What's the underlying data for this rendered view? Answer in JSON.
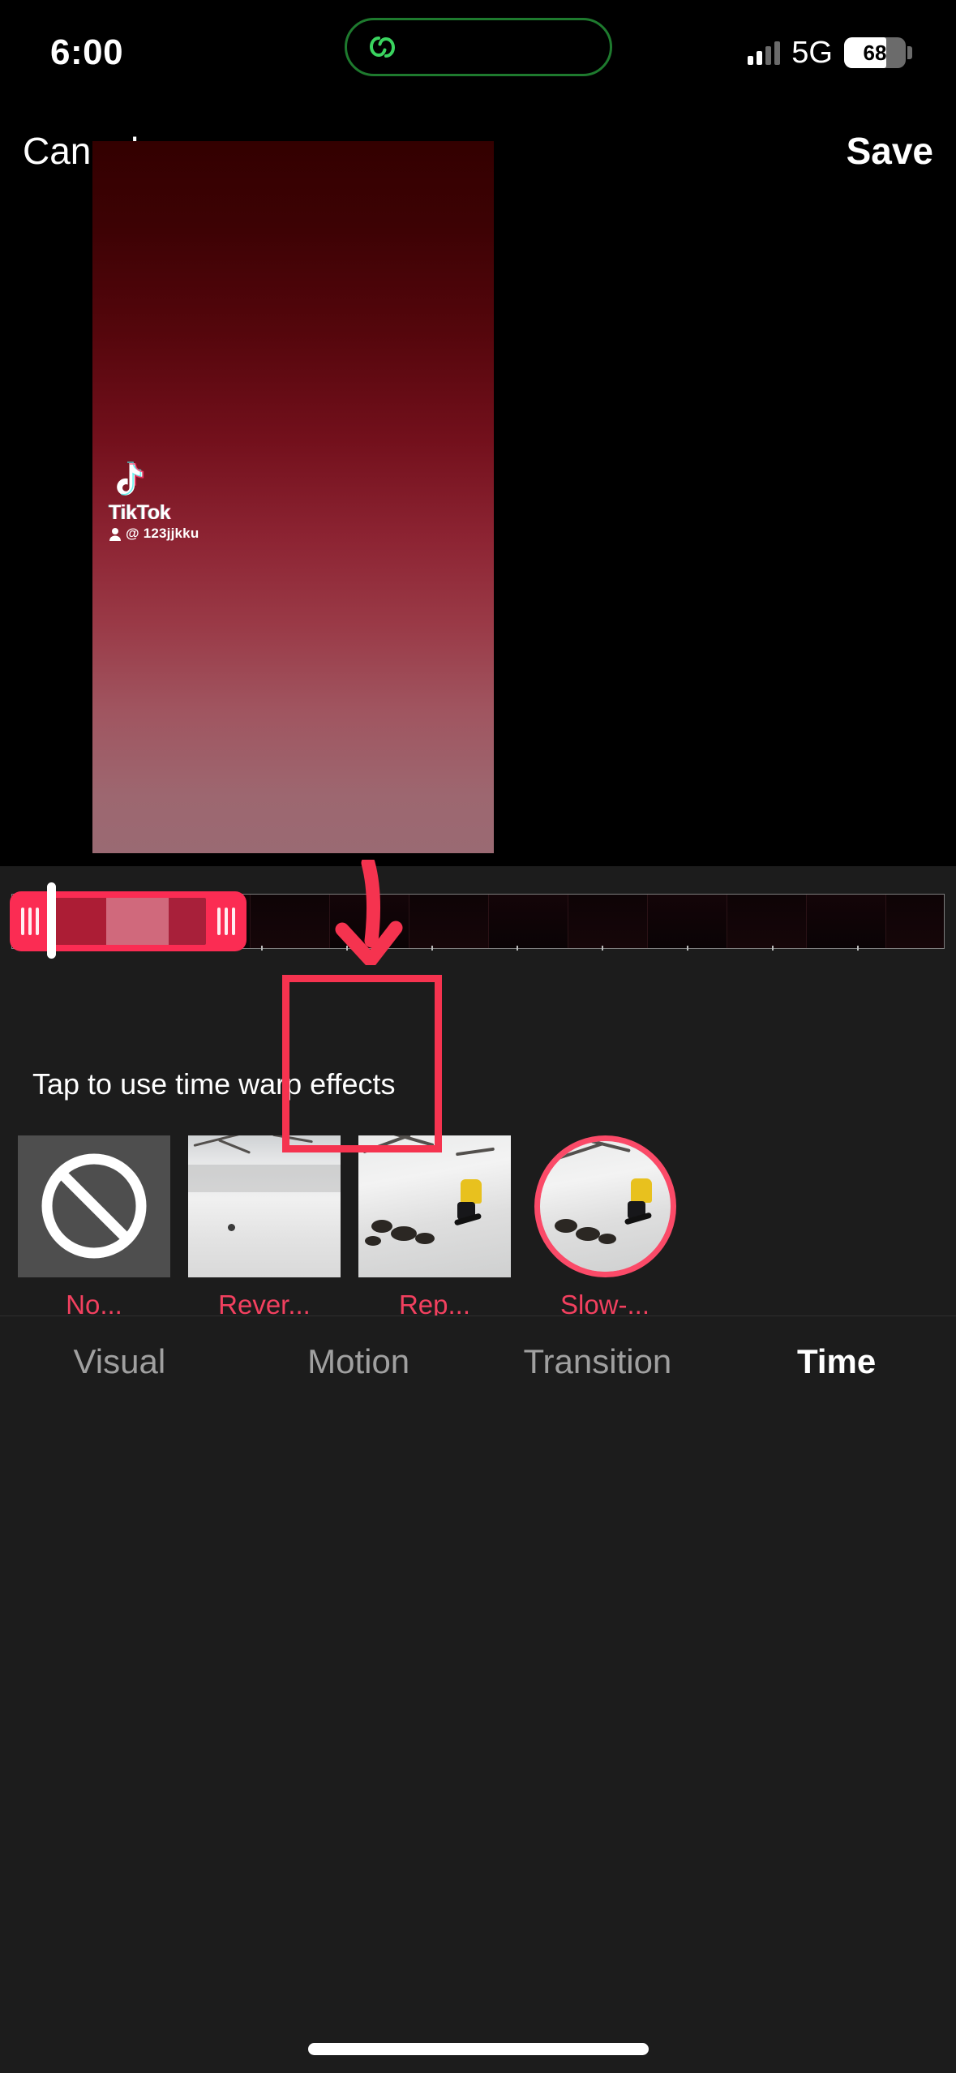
{
  "status_bar": {
    "time": "6:00",
    "network": "5G",
    "battery_level": "68",
    "island_icon": "link-chain-icon",
    "signal_icon": "cellular-bars-icon"
  },
  "nav_bar": {
    "cancel_label": "Cancel",
    "save_label": "Save"
  },
  "video_preview": {
    "watermark": {
      "brand": "TikTok",
      "handle": "@ 123jjkku",
      "logo_icon": "tiktok-note-icon",
      "user_icon": "person-icon"
    }
  },
  "timeline": {
    "frame_count": 12,
    "tick_count": 10,
    "trim_handle_icon": "trim-grip-icon",
    "playhead_icon": "playhead-icon"
  },
  "effects": {
    "hint": "Tap to use time warp effects",
    "items": [
      {
        "label": "No...",
        "icon": "no-effect-icon",
        "selected": false
      },
      {
        "label": "Rever...",
        "icon": "reverse-thumbnail",
        "selected": false
      },
      {
        "label": "Rep...",
        "icon": "repeat-thumbnail",
        "selected": false
      },
      {
        "label": "Slow-...",
        "icon": "slow-motion-thumbnail",
        "selected": true
      }
    ]
  },
  "tabs": [
    {
      "label": "Visual",
      "active": false
    },
    {
      "label": "Motion",
      "active": false
    },
    {
      "label": "Transition",
      "active": false
    },
    {
      "label": "Time",
      "active": true
    }
  ],
  "annotation": {
    "highlight_color": "#f5334f",
    "arrow_color": "#f5334f"
  },
  "colors": {
    "accent": "#fb2c53",
    "effect_label": "#f2405f",
    "panel_bg": "#1c1c1c"
  }
}
